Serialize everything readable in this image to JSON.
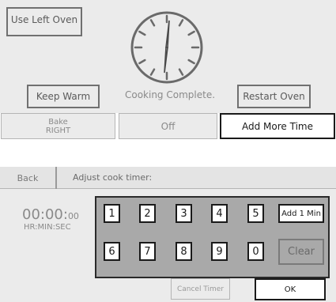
{
  "top": {
    "use_left_oven": "Use Left Oven",
    "keep_warm": "Keep Warm",
    "status": "Cooking Complete.",
    "restart_oven": "Restart Oven",
    "tabs": {
      "bake": "Bake",
      "bake_sub": "RIGHT",
      "off": "Off",
      "add_more_time": "Add More Time"
    }
  },
  "timer": {
    "back": "Back",
    "title": "Adjust cook timer:",
    "time": "00:00:",
    "seconds": "00",
    "format": "HR:MIN:SEC",
    "keys": [
      "1",
      "2",
      "3",
      "4",
      "5",
      "6",
      "7",
      "8",
      "9",
      "0"
    ],
    "add_1_min": "Add 1 Min",
    "clear": "Clear",
    "cancel_timer": "Cancel Timer",
    "ok": "OK"
  },
  "colors": {
    "panel": "#ebebeb",
    "keypad": "#a9a9a9",
    "outline": "#707070"
  }
}
